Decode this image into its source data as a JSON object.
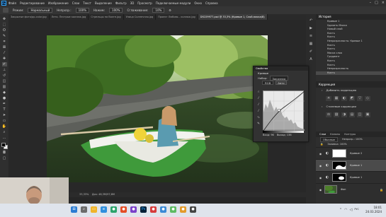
{
  "menubar": {
    "logo": "Ps",
    "items": [
      "Файл",
      "Редактирование",
      "Изображение",
      "Слои",
      "Текст",
      "Выделение",
      "Фильтр",
      "3D",
      "Просмотр",
      "Подключаемые модули",
      "Окно",
      "Справка"
    ]
  },
  "options": {
    "mode_label": "Режим:",
    "mode_value": "Нормальный",
    "opacity_label": "Непрозр.:",
    "opacity_value": "100%",
    "pressure_label": "Нажим:",
    "pressure_value": "100%",
    "smooth_label": "Сглаживание:",
    "smooth_value": "10%"
  },
  "tabs": [
    {
      "label": "Закрытые фото/pp-color.jpg",
      "active": false
    },
    {
      "label": "Лето. Пестрые коллаж.jpg",
      "active": false
    },
    {
      "label": "Стрельцы на Волге.jpg",
      "active": false
    },
    {
      "label": "Улица Солнечная.jpg",
      "active": false
    },
    {
      "label": "Проект Любовь - коллаж.jpg",
      "active": false
    },
    {
      "label": "DSC09977.psd @ 33,3% (Кривые 1, Слой-маска/8)",
      "active": true
    }
  ],
  "status": {
    "zoom": "33,33%",
    "doc": "Док: 48,3M/97,6M"
  },
  "history": {
    "title": "История",
    "items": [
      "Кривые 1",
      "Удалить Маска",
      "Новый слой",
      "Кисть",
      "Кисть",
      "Непрозрачность: Кривые 1",
      "Кисть",
      "Кисть",
      "Маска слоя",
      "Градиент",
      "Кисть",
      "Кисть",
      "Непрозрачность",
      "Кисть"
    ],
    "selected_index": 13
  },
  "properties": {
    "title": "Коррекция",
    "add_label": "Добавить коррекцию",
    "presets_label": "Стилевые коррекции",
    "row1": [
      "☀",
      "▦",
      "◐",
      "◩",
      "▽",
      "◇"
    ],
    "row2": [
      "⚖",
      "▨",
      "◑",
      "▤",
      "◫",
      "▣"
    ]
  },
  "layers": {
    "tabs": [
      "Слои",
      "Каналы",
      "Контуры"
    ],
    "active_tab": 0,
    "blend": "Обычные",
    "opacity": "Непрозр.: 100%",
    "fill": "Заливка: 100%",
    "rows": [
      {
        "name": "Кривые 2",
        "type": "adjustment",
        "mask": "white",
        "selected": false
      },
      {
        "name": "Кривые 1",
        "type": "adjustment",
        "mask": "black-a",
        "selected": true
      },
      {
        "name": "Кривые 1",
        "type": "adjustment",
        "mask": "black-b",
        "selected": false
      },
      {
        "name": "Фон",
        "type": "image",
        "mask": "none",
        "selected": false
      }
    ]
  },
  "curves": {
    "panel_title": "Свойства",
    "title": "Кривые",
    "preset_label": "Набор:",
    "preset_value": "Заказная",
    "channel_value": "RGB",
    "auto_label": "Авто",
    "input_label": "Вход: 96",
    "output_label": "Выход: 138"
  },
  "taskbar": {
    "time": "18:01",
    "date": "24.03.2024",
    "lang": "РУС"
  },
  "colors": {
    "ps_blue": "#31a8ff",
    "panel_bg": "#2e2e2e",
    "selection": "#4b4b4b"
  }
}
